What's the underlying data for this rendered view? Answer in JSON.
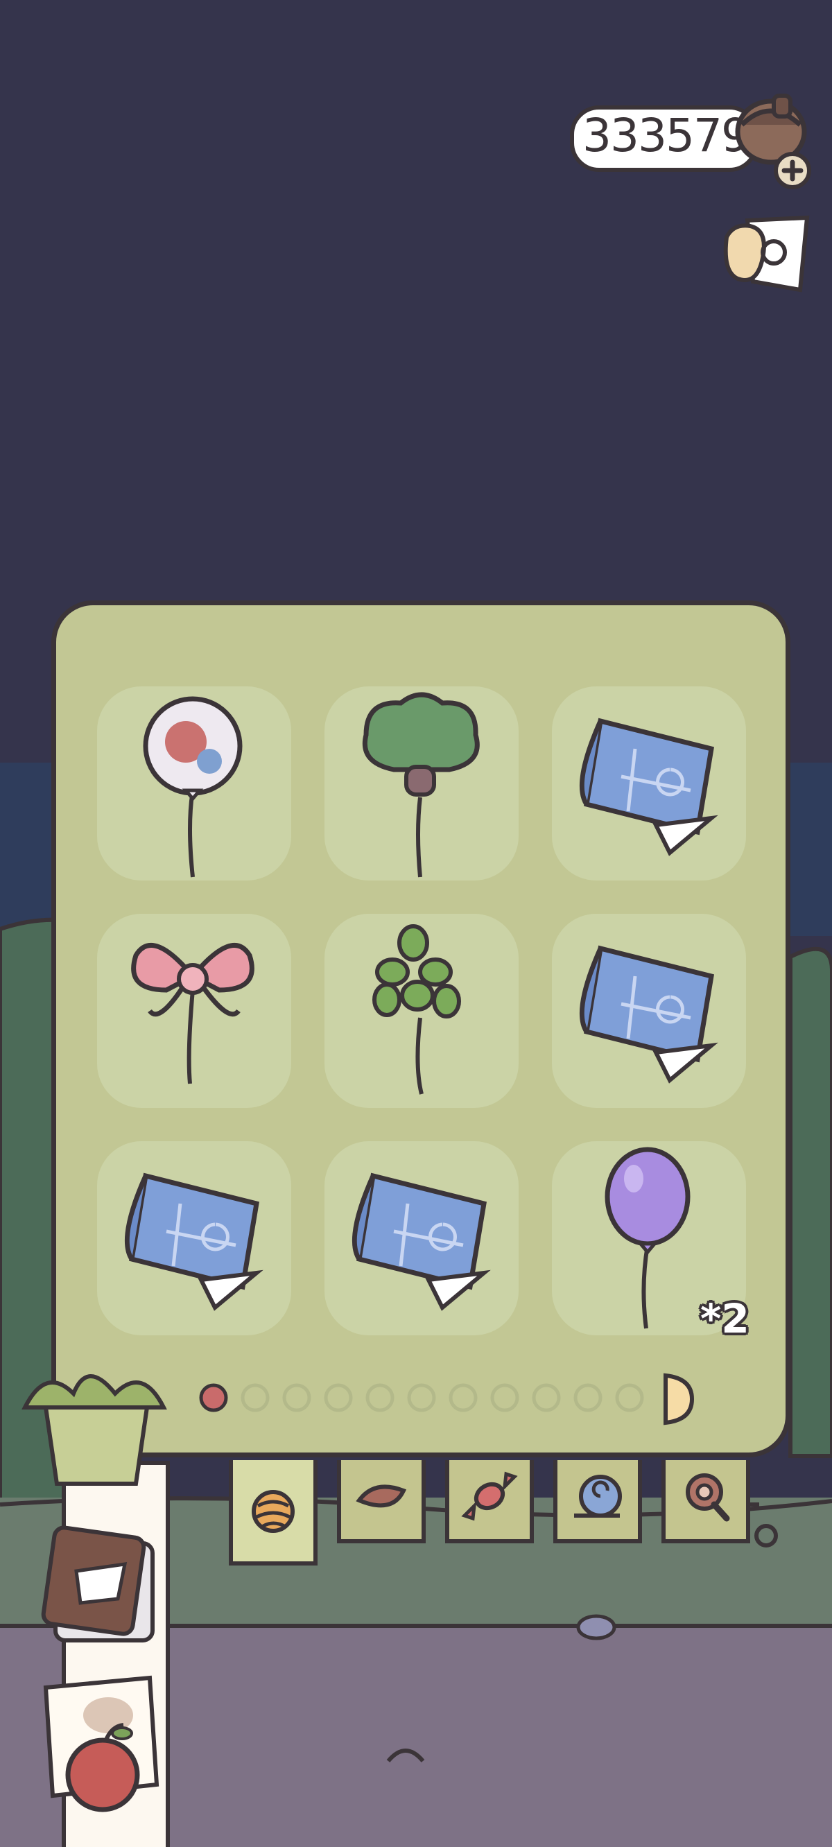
{
  "hud": {
    "currency_value": "333579",
    "currency_icon": "acorn-coin-icon",
    "add_icon": "plus-icon",
    "map_icon": "memo-map-icon"
  },
  "gift_panel": {
    "items": [
      {
        "name": "photo-balloon",
        "icon": "photo-balloon-icon",
        "quantity": ""
      },
      {
        "name": "tree-balloon",
        "icon": "tree-balloon-icon",
        "quantity": ""
      },
      {
        "name": "blueprint",
        "icon": "blueprint-icon",
        "quantity": ""
      },
      {
        "name": "bow-balloon",
        "icon": "bow-balloon-icon",
        "quantity": ""
      },
      {
        "name": "grape-balloon",
        "icon": "grape-balloon-icon",
        "quantity": ""
      },
      {
        "name": "blueprint",
        "icon": "blueprint-icon",
        "quantity": ""
      },
      {
        "name": "blueprint",
        "icon": "blueprint-icon",
        "quantity": ""
      },
      {
        "name": "blueprint",
        "icon": "blueprint-icon",
        "quantity": ""
      },
      {
        "name": "purple-balloon",
        "icon": "purple-balloon-icon",
        "quantity": "*2"
      }
    ],
    "pagination": {
      "current_page": 1,
      "total_pages": 11
    },
    "colors": {
      "active_dot": "#c96b6b",
      "inactive_dot": "#b3b98a"
    }
  },
  "category_tabs": [
    {
      "icon": "yarn-ball-icon",
      "active": true
    },
    {
      "icon": "leaf-icon",
      "active": false
    },
    {
      "icon": "candy-icon",
      "active": false
    },
    {
      "icon": "snail-shell-icon",
      "active": false
    },
    {
      "icon": "magnifier-icon",
      "active": false
    }
  ],
  "side_menu": [
    {
      "icon": "lettuce-bag-icon"
    },
    {
      "icon": "journal-icon"
    },
    {
      "icon": "photo-apple-icon"
    }
  ]
}
